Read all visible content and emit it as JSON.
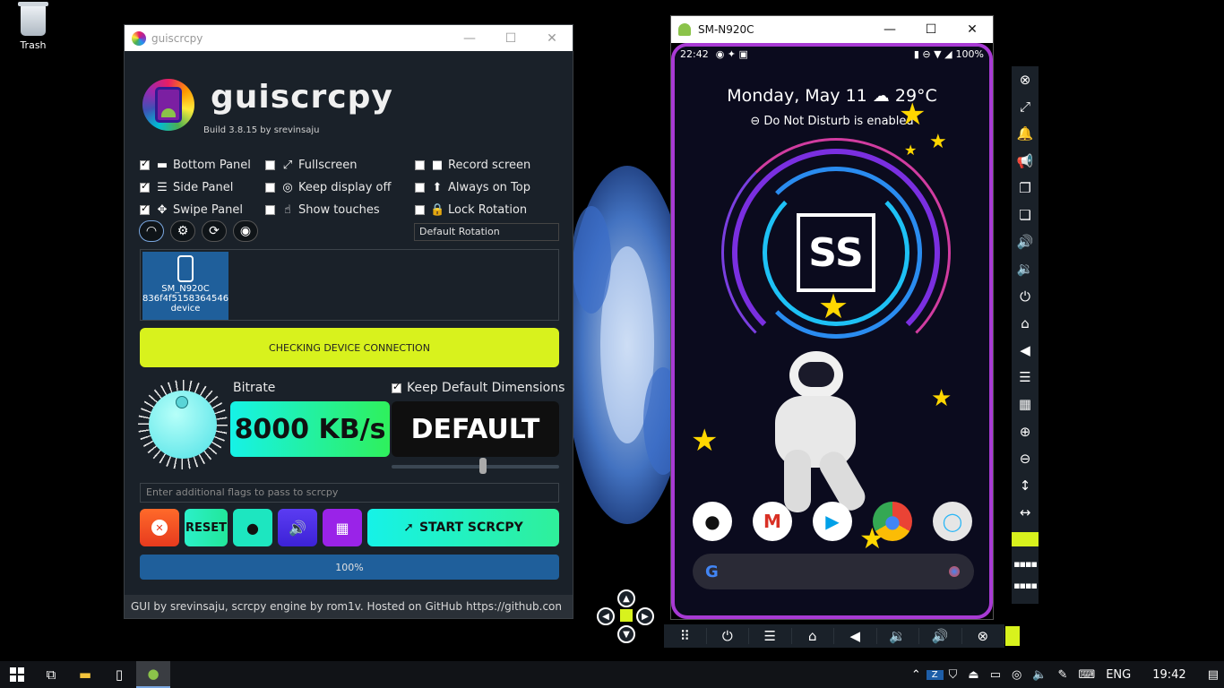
{
  "desktop": {
    "trash_label": "Trash"
  },
  "gui": {
    "window_title": "guiscrcpy",
    "app_name": "guiscrcpy",
    "build": "Build 3.8.15 by srevinsaju",
    "options_col1": [
      {
        "label": "Bottom Panel",
        "checked": true,
        "icon": "bottom-panel-icon",
        "glyph": "▬"
      },
      {
        "label": "Side Panel",
        "checked": true,
        "icon": "side-panel-icon",
        "glyph": "☰"
      },
      {
        "label": "Swipe Panel",
        "checked": true,
        "icon": "swipe-panel-icon",
        "glyph": "✥"
      }
    ],
    "options_col2": [
      {
        "label": "Fullscreen",
        "checked": false,
        "icon": "fullscreen-icon",
        "glyph": "⤢"
      },
      {
        "label": "Keep display off",
        "checked": false,
        "icon": "display-off-icon",
        "glyph": "◎"
      },
      {
        "label": "Show touches",
        "checked": false,
        "icon": "touch-icon",
        "glyph": "☝"
      }
    ],
    "options_col3": [
      {
        "label": "Record screen",
        "checked": false,
        "icon": "record-icon",
        "glyph": "■"
      },
      {
        "label": "Always on Top",
        "checked": false,
        "icon": "pin-icon",
        "glyph": "⬆"
      },
      {
        "label": "Lock Rotation",
        "checked": false,
        "icon": "lock-icon",
        "glyph": "🔒"
      }
    ],
    "rotation_value": "Default Rotation",
    "device": {
      "name": "SM_N920C",
      "serial": "836f4f5158364546",
      "status": "device"
    },
    "checking_label": "CHECKING DEVICE CONNECTION",
    "bitrate_label": "Bitrate",
    "bitrate_value": "8000 KB/s",
    "dims_label": "Keep Default Dimensions",
    "dims_value": "DEFAULT",
    "flags_placeholder": "Enter additional flags to pass to scrcpy",
    "reset_label": "RESET",
    "start_label": "START SCRCPY",
    "progress_label": "100%",
    "progress": 1.0,
    "status_text": "GUI by srevinsaju, scrcpy engine by rom1v. Hosted on GitHub",
    "status_url": "https://github.con"
  },
  "phone": {
    "window_title": "SM-N920C",
    "time": "22:42",
    "battery": "100%",
    "date": "Monday, May 11  ☁ 29°C",
    "dnd": "⊖  Do Not Disturb is enabled",
    "logo_text": "SS",
    "google": "G"
  },
  "taskbar": {
    "lang": "ENG",
    "clock": "19:42"
  },
  "colors": {
    "accent_lime": "#d8f21d",
    "accent_teal": "#16f2e7",
    "panel_bg": "#1a2129",
    "blue": "#1f5f9b"
  }
}
